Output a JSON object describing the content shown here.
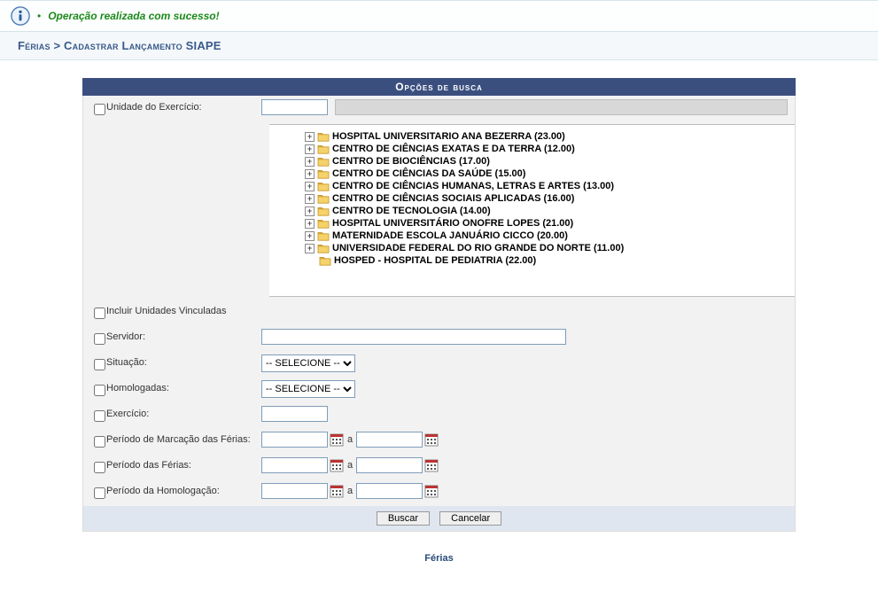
{
  "success_message": "Operação realizada com sucesso!",
  "breadcrumb": "Férias > Cadastrar Lançamento SIAPE",
  "panel_title": "Opções de busca",
  "labels": {
    "unidade": "Unidade do Exercício:",
    "incluir": "Incluir Unidades Vinculadas",
    "servidor": "Servidor:",
    "situacao": "Situação:",
    "homologadas": "Homologadas:",
    "exercicio": "Exercício:",
    "periodo_marcacao": "Período de Marcação das Férias:",
    "periodo_ferias": "Período das Férias:",
    "periodo_homolog": "Período da Homologação:",
    "a": "a"
  },
  "selects": {
    "selecione": "-- SELECIONE --"
  },
  "buttons": {
    "buscar": "Buscar",
    "cancelar": "Cancelar"
  },
  "tree": [
    {
      "label": "HOSPITAL UNIVERSITARIO ANA BEZERRA (23.00)"
    },
    {
      "label": "CENTRO DE CIÊNCIAS EXATAS E DA TERRA (12.00)"
    },
    {
      "label": "CENTRO DE BIOCIÊNCIAS (17.00)"
    },
    {
      "label": "CENTRO DE CIÊNCIAS DA SAÚDE (15.00)"
    },
    {
      "label": "CENTRO DE CIÊNCIAS HUMANAS, LETRAS E ARTES (13.00)"
    },
    {
      "label": "CENTRO DE CIÊNCIAS SOCIAIS APLICADAS (16.00)"
    },
    {
      "label": "CENTRO DE TECNOLOGIA (14.00)"
    },
    {
      "label": "HOSPITAL UNIVERSITÁRIO ONOFRE LOPES (21.00)"
    },
    {
      "label": "MATERNIDADE ESCOLA JANUÁRIO CICCO (20.00)"
    },
    {
      "label": "UNIVERSIDADE FEDERAL DO RIO GRANDE DO NORTE (11.00)"
    },
    {
      "label": "HOSPED - HOSPITAL DE PEDIATRIA (22.00)"
    }
  ],
  "footer": "Férias"
}
